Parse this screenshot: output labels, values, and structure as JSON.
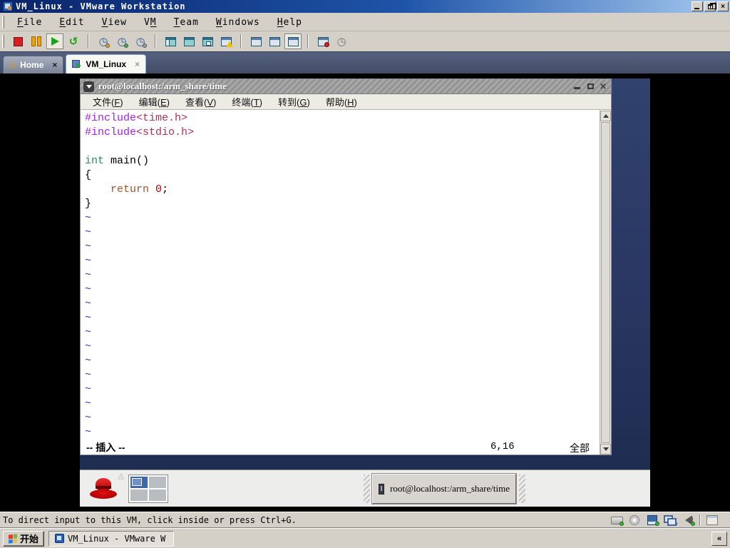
{
  "window": {
    "title": "VM_Linux - VMware Workstation",
    "close_glyph": "×"
  },
  "host_menu": {
    "items": [
      {
        "pre": "",
        "key": "F",
        "post": "ile"
      },
      {
        "pre": "",
        "key": "E",
        "post": "dit"
      },
      {
        "pre": "",
        "key": "V",
        "post": "iew"
      },
      {
        "pre": "V",
        "key": "M",
        "post": ""
      },
      {
        "pre": "",
        "key": "T",
        "post": "eam"
      },
      {
        "pre": "",
        "key": "W",
        "post": "indows"
      },
      {
        "pre": "",
        "key": "H",
        "post": "elp"
      }
    ]
  },
  "toolbar": {
    "groups": [
      [
        "stop-icon",
        "pause-icon",
        "play-icon",
        "reset-icon"
      ],
      [
        "snapshot-take-icon",
        "snapshot-revert-icon",
        "snapshot-manager-icon"
      ],
      [
        "sidebar-toggle-icon",
        "fullscreen-icon",
        "quick-switch-icon",
        "unity-icon"
      ],
      [
        "vm-settings-icon",
        "summary-view-icon",
        "console-view-icon"
      ],
      [
        "record-movie-icon",
        "clock-icon"
      ]
    ],
    "pressed": [
      "play-icon",
      "console-view-icon"
    ]
  },
  "tabs": [
    {
      "label": "Home",
      "close": "×",
      "active": false
    },
    {
      "label": "VM_Linux",
      "close": "×",
      "active": true
    }
  ],
  "terminal": {
    "title": "root@localhost:/arm_share/time",
    "menu": [
      {
        "label": "文件",
        "key": "F"
      },
      {
        "label": "编辑",
        "key": "E"
      },
      {
        "label": "查看",
        "key": "V"
      },
      {
        "label": "终端",
        "key": "T"
      },
      {
        "label": "转到",
        "key": "G"
      },
      {
        "label": "帮助",
        "key": "H"
      }
    ],
    "code": [
      [
        {
          "t": "#include",
          "c": "p"
        },
        {
          "t": "<time.h>",
          "c": "s"
        }
      ],
      [
        {
          "t": "#include",
          "c": "p"
        },
        {
          "t": "<stdio.h>",
          "c": "s"
        }
      ],
      [],
      [
        {
          "t": "int",
          "c": "t"
        },
        {
          "t": " main()",
          "c": "d"
        }
      ],
      [
        {
          "t": "{",
          "c": "d"
        }
      ],
      [
        {
          "t": "    ",
          "c": "d"
        },
        {
          "t": "return",
          "c": "k"
        },
        {
          "t": " ",
          "c": "d"
        },
        {
          "t": "0",
          "c": "n"
        },
        {
          "t": ";",
          "c": "d"
        }
      ],
      [
        {
          "t": "}",
          "c": "d"
        }
      ]
    ],
    "tilde": "~",
    "tilde_count": 16,
    "status": {
      "mode": "-- 插入 --",
      "position": "6,16",
      "scroll": "全部"
    }
  },
  "guest_panel": {
    "menu_marker": "△",
    "task_label": "root@localhost:/arm_share/time"
  },
  "vmware_status": {
    "message": "To direct input to this VM, click inside or press Ctrl+G.",
    "devices": [
      "harddisk-icon",
      "cdrom-icon",
      "floppy-icon",
      "network-icon",
      "sound-icon"
    ],
    "extra": [
      "message-icon"
    ]
  },
  "win_taskbar": {
    "start_label": "开始",
    "task_label": "VM_Linux - VMware W...",
    "collapse_label": "«"
  }
}
